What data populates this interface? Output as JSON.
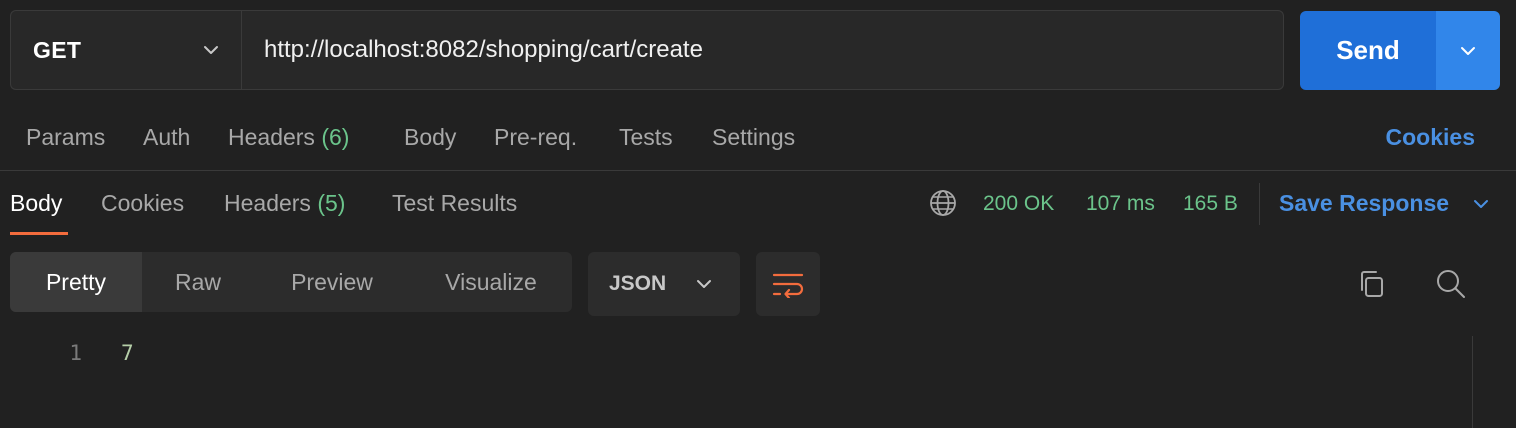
{
  "request": {
    "method": "GET",
    "url": "http://localhost:8082/shopping/cart/create",
    "send_label": "Send"
  },
  "request_tabs": {
    "params": "Params",
    "auth": "Auth",
    "headers": "Headers",
    "headers_count": "(6)",
    "body": "Body",
    "prereq": "Pre-req.",
    "tests": "Tests",
    "settings": "Settings",
    "cookies": "Cookies"
  },
  "response_tabs": {
    "body": "Body",
    "cookies": "Cookies",
    "headers": "Headers",
    "headers_count": "(5)",
    "test_results": "Test Results"
  },
  "response_meta": {
    "status": "200 OK",
    "time": "107 ms",
    "size": "165 B",
    "save_response": "Save Response"
  },
  "format": {
    "modes": [
      "Pretty",
      "Raw",
      "Preview",
      "Visualize"
    ],
    "active_mode": "Pretty",
    "language": "JSON"
  },
  "body_lines": [
    {
      "num": "1",
      "code": "7"
    }
  ],
  "colors": {
    "accent_blue": "#1f6fd8",
    "status_green": "#6bc48b",
    "tab_underline": "#f36c3d",
    "link_blue": "#4a90e2"
  }
}
